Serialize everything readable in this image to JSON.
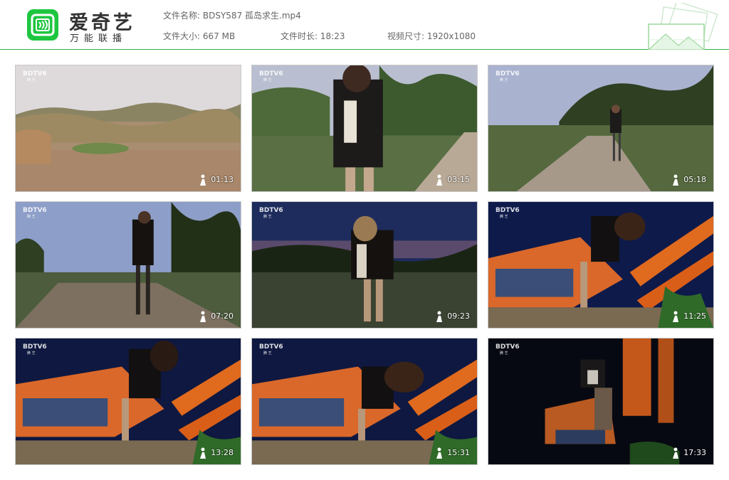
{
  "brand": {
    "name": "爱奇艺",
    "slogan": "万能联播"
  },
  "file": {
    "name_label": "文件名称:",
    "name": "BDSY587 孤岛求生.mp4",
    "size_label": "文件大小:",
    "size": "667 MB",
    "duration_label": "文件时长:",
    "duration": "18:23",
    "dimension_label": "视频尺寸:",
    "dimension": "1920x1080"
  },
  "thumbnails": [
    {
      "time": "01:13",
      "watermark": "BDTV6",
      "scene": "dusk-field"
    },
    {
      "time": "03:15",
      "watermark": "BDTV6",
      "scene": "woman-path"
    },
    {
      "time": "05:18",
      "watermark": "BDTV6",
      "scene": "dirt-road-far"
    },
    {
      "time": "07:20",
      "watermark": "BDTV6",
      "scene": "road-walk"
    },
    {
      "time": "09:23",
      "watermark": "BDTV6",
      "scene": "night-field"
    },
    {
      "time": "11:25",
      "watermark": "BDTV6",
      "scene": "excavator"
    },
    {
      "time": "13:28",
      "watermark": "BDTV6",
      "scene": "excavator"
    },
    {
      "time": "15:31",
      "watermark": "BDTV6",
      "scene": "excavator"
    },
    {
      "time": "17:33",
      "watermark": "BDTV6",
      "scene": "excavator-dark"
    }
  ],
  "colors": {
    "accent": "#1ec640",
    "rule": "#2fb24a"
  }
}
